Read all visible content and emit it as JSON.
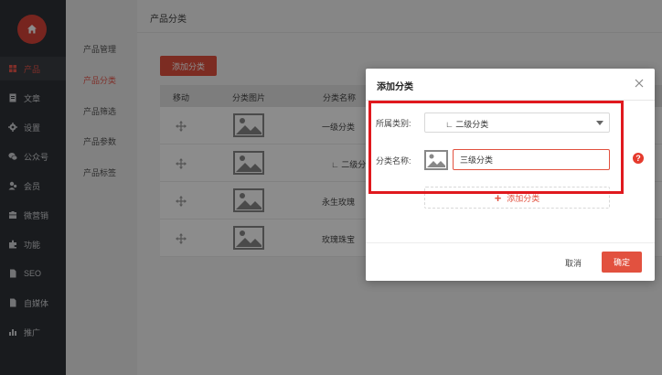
{
  "sidebar": {
    "logo_icon": "home-icon",
    "items": [
      {
        "label": "产品",
        "icon": "grid-icon",
        "active": true
      },
      {
        "label": "文章",
        "icon": "document-icon"
      },
      {
        "label": "设置",
        "icon": "gear-icon"
      },
      {
        "label": "公众号",
        "icon": "wechat-icon"
      },
      {
        "label": "会员",
        "icon": "user-icon"
      },
      {
        "label": "微营销",
        "icon": "store-icon"
      },
      {
        "label": "功能",
        "icon": "puzzle-icon"
      },
      {
        "label": "SEO",
        "icon": "file-icon"
      },
      {
        "label": "自媒体",
        "icon": "file-icon"
      },
      {
        "label": "推广",
        "icon": "bar-chart-icon"
      }
    ]
  },
  "subnav": {
    "items": [
      {
        "label": "产品管理"
      },
      {
        "label": "产品分类",
        "active": true
      },
      {
        "label": "产品筛选"
      },
      {
        "label": "产品参数"
      },
      {
        "label": "产品标签"
      }
    ]
  },
  "main": {
    "title": "产品分类",
    "add_button": "添加分类",
    "table": {
      "headers": [
        "移动",
        "分类图片",
        "分类名称"
      ],
      "rows": [
        {
          "name": "一级分类"
        },
        {
          "name": "∟ 二级分"
        },
        {
          "name": "永生玫瑰"
        },
        {
          "name": "玫瑰珠宝"
        }
      ]
    }
  },
  "dialog": {
    "title": "添加分类",
    "parent_label": "所属类别:",
    "parent_value": "∟ 二级分类",
    "name_label": "分类名称:",
    "name_value": "三级分类",
    "add_sub_label": "添加分类",
    "help_glyph": "?",
    "cancel_label": "取消",
    "ok_label": "确定"
  },
  "colors": {
    "accent": "#e2513f",
    "sidebar_bg": "#2f3237",
    "highlight": "#e0191e"
  }
}
